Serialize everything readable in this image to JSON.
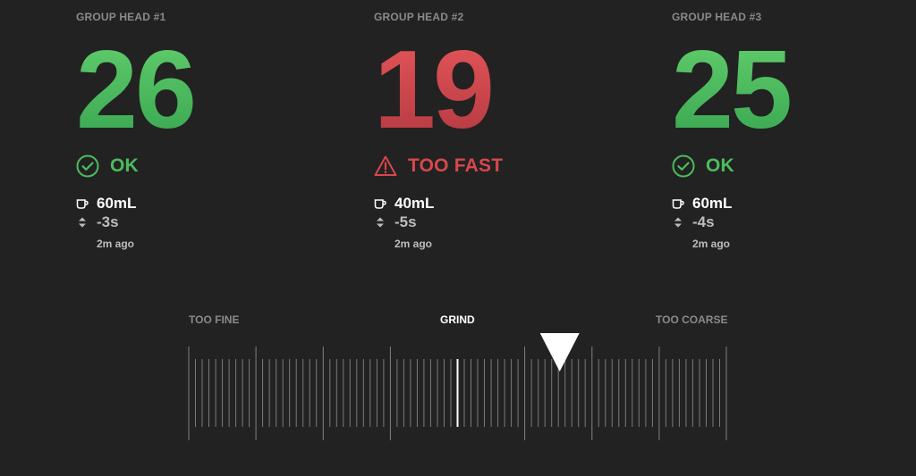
{
  "group_heads": [
    {
      "label": "GROUP HEAD #1",
      "shot_time": "26",
      "status": "OK",
      "status_kind": "ok",
      "status_icon": "check-circle-icon",
      "volume": "60mL",
      "delta": "-3s",
      "ago": "2m ago"
    },
    {
      "label": "GROUP HEAD #2",
      "shot_time": "19",
      "status": "TOO FAST",
      "status_kind": "bad",
      "status_icon": "warning-triangle-icon",
      "volume": "40mL",
      "delta": "-5s",
      "ago": "2m ago"
    },
    {
      "label": "GROUP HEAD #3",
      "shot_time": "25",
      "status": "OK",
      "status_kind": "ok",
      "status_icon": "check-circle-icon",
      "volume": "60mL",
      "delta": "-4s",
      "ago": "2m ago"
    }
  ],
  "grind": {
    "fine_label": "TOO FINE",
    "center_label": "GRIND",
    "coarse_label": "TOO COARSE",
    "indicator_icon": "triangle-down-icon",
    "indicator_position": 0.69
  },
  "icons": {
    "volume": "cup-icon",
    "delta": "up-down-arrows-icon"
  },
  "colors": {
    "background": "#222222",
    "ok": "#4cbb5e",
    "bad": "#d6484c",
    "muted": "#8a8a8a",
    "secondary": "#bdbdbd",
    "tick": "#9a9a9a"
  }
}
